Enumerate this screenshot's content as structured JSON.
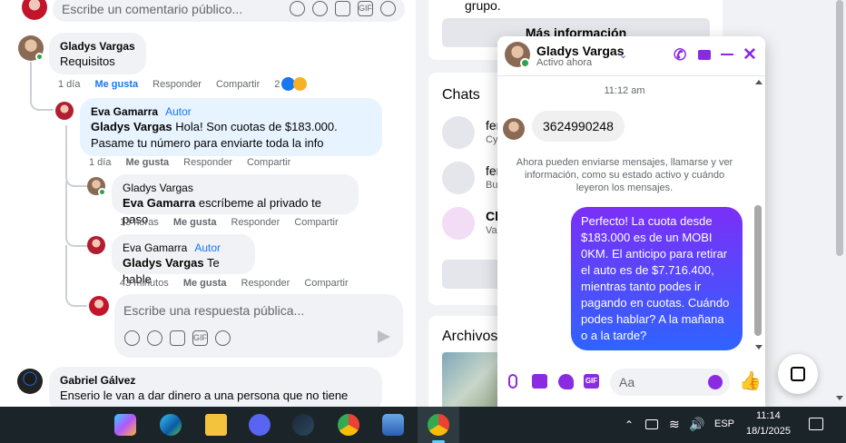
{
  "top_comment_input": {
    "placeholder": "Escribe un comentario público..."
  },
  "comments": [
    {
      "author": "Gladys Vargas",
      "text": "Requisitos",
      "time": "1 día",
      "like": "Me gusta",
      "reply": "Responder",
      "share": "Compartir",
      "reactions": "2"
    },
    {
      "author": "Eva Gamarra",
      "badge": "Autor",
      "mention": "Gladys Vargas",
      "text_line1": " Hola! Son cuotas de $183.000.",
      "text_line2": "Pasame tu número para enviarte toda la info",
      "time": "1 día",
      "like": "Me gusta",
      "reply": "Responder",
      "share": "Compartir"
    },
    {
      "author": "Gladys Vargas",
      "mention": "Eva Gamarra",
      "text": " escríbeme al privado te paso",
      "time": "13 horas",
      "like": "Me gusta",
      "reply": "Responder",
      "share": "Compartir"
    },
    {
      "author": "Eva Gamarra",
      "badge": "Autor",
      "mention": "Gladys Vargas",
      "text": " Te hable",
      "time": "43 minutos",
      "like": "Me gusta",
      "reply": "Responder",
      "share": "Compartir"
    },
    {
      "author": "Gabriel Gálvez",
      "text": "Enserio le van a dar dinero a una persona que no tiene"
    }
  ],
  "reply_input": {
    "placeholder": "Escribe una respuesta pública..."
  },
  "right_panel": {
    "group_text": "grupo.",
    "more_info": "Más información",
    "chats_title": "Chats",
    "chats": [
      {
        "name": "fer",
        "preview": "Cy"
      },
      {
        "name": "fer",
        "preview": "Bu"
      },
      {
        "name": "Ch",
        "preview": "Val"
      }
    ],
    "files_title": "Archivos"
  },
  "chat_popup": {
    "name": "Gladys Vargas",
    "status": "Activo ahora",
    "timestamp": "11:12 am",
    "received_message": "3624990248",
    "system_notice": "Ahora pueden enviarse mensajes, llamarse y ver información, como su estado activo y cuándo leyeron los mensajes.",
    "sent_message": "Perfecto! La cuota desde $183.000 es de un MOBI 0KM. El anticipo para retirar el auto es de $7.716.400, mientras tanto podes ir pagando en cuotas. Cuándo podes hablar? A la mañana o a la tarde?",
    "input_placeholder": "Aa",
    "accent_color": "#8a2be2"
  },
  "taskbar": {
    "language": "ESP",
    "time": "11:14",
    "date": "18/1/2025"
  }
}
